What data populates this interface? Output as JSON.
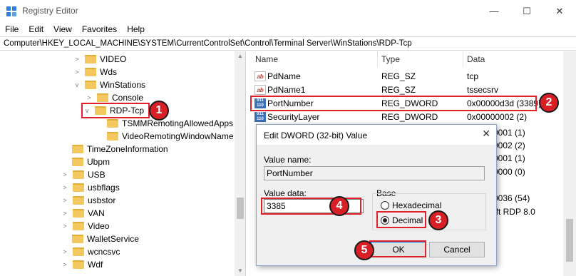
{
  "window": {
    "title": "Registry Editor",
    "min_glyph": "—",
    "max_glyph": "☐",
    "close_glyph": "✕"
  },
  "menu": [
    "File",
    "Edit",
    "View",
    "Favorites",
    "Help"
  ],
  "address": "Computer\\HKEY_LOCAL_MACHINE\\SYSTEM\\CurrentControlSet\\Control\\Terminal Server\\WinStations\\RDP-Tcp",
  "tree": [
    {
      "label": "VIDEO",
      "expander": "collapsed"
    },
    {
      "label": "Wds",
      "expander": "collapsed"
    },
    {
      "label": "WinStations",
      "expander": "expanded"
    },
    {
      "label": "Console",
      "expander": "collapsed"
    },
    {
      "label": "RDP-Tcp",
      "expander": "expanded"
    },
    {
      "label": "TSMMRemotingAllowedApps",
      "expander": "none"
    },
    {
      "label": "VideoRemotingWindowName",
      "expander": "none"
    },
    {
      "label": "TimeZoneInformation",
      "expander": "none"
    },
    {
      "label": "Ubpm",
      "expander": "none"
    },
    {
      "label": "USB",
      "expander": "collapsed"
    },
    {
      "label": "usbflags",
      "expander": "collapsed"
    },
    {
      "label": "usbstor",
      "expander": "collapsed"
    },
    {
      "label": "VAN",
      "expander": "collapsed"
    },
    {
      "label": "Video",
      "expander": "collapsed"
    },
    {
      "label": "WalletService",
      "expander": "none"
    },
    {
      "label": "wcncsvc",
      "expander": "collapsed"
    },
    {
      "label": "Wdf",
      "expander": "collapsed"
    }
  ],
  "values_header": {
    "name": "Name",
    "type": "Type",
    "data": "Data"
  },
  "values": [
    {
      "icon": "string-value-icon",
      "icon_text": "ab",
      "name": "PdName",
      "type": "REG_SZ",
      "data": "tcp"
    },
    {
      "icon": "string-value-icon",
      "icon_text": "ab",
      "name": "PdName1",
      "type": "REG_SZ",
      "data": "tssecsrv"
    },
    {
      "icon": "dword-value-icon",
      "icon_text": "011 110",
      "name": "PortNumber",
      "type": "REG_DWORD",
      "data": "0x00000d3d (3389)"
    },
    {
      "icon": "dword-value-icon",
      "icon_text": "011 110",
      "name": "SecurityLayer",
      "type": "REG_DWORD",
      "data": "0x00000002 (2)"
    },
    {
      "icon": "",
      "icon_text": "",
      "name": "",
      "type": "",
      "data": "0001 (1)"
    },
    {
      "icon": "",
      "icon_text": "",
      "name": "",
      "type": "",
      "data": "0002 (2)"
    },
    {
      "icon": "",
      "icon_text": "",
      "name": "",
      "type": "",
      "data": "0001 (1)"
    },
    {
      "icon": "",
      "icon_text": "",
      "name": "",
      "type": "",
      "data": "0000 (0)"
    },
    {
      "icon": "",
      "icon_text": "",
      "name": "",
      "type": "",
      "data": ""
    },
    {
      "icon": "",
      "icon_text": "",
      "name": "",
      "type": "",
      "data": "0036 (54)"
    },
    {
      "icon": "",
      "icon_text": "",
      "name": "",
      "type": "",
      "data": "oft RDP 8.0"
    }
  ],
  "dialog": {
    "title": "Edit DWORD (32-bit) Value",
    "value_name_label": "Value name:",
    "value_name": "PortNumber",
    "value_data_label": "Value data:",
    "value_data": "3385",
    "base_label": "Base",
    "hex_label": "Hexadecimal",
    "dec_label": "Decimal",
    "ok_label": "OK",
    "cancel_label": "Cancel",
    "close_glyph": "✕"
  },
  "badges": [
    "1",
    "2",
    "3",
    "4",
    "5"
  ],
  "colors": {
    "highlight": "#e0202a",
    "badge": "#d91f26",
    "folder": "#f4c860"
  }
}
